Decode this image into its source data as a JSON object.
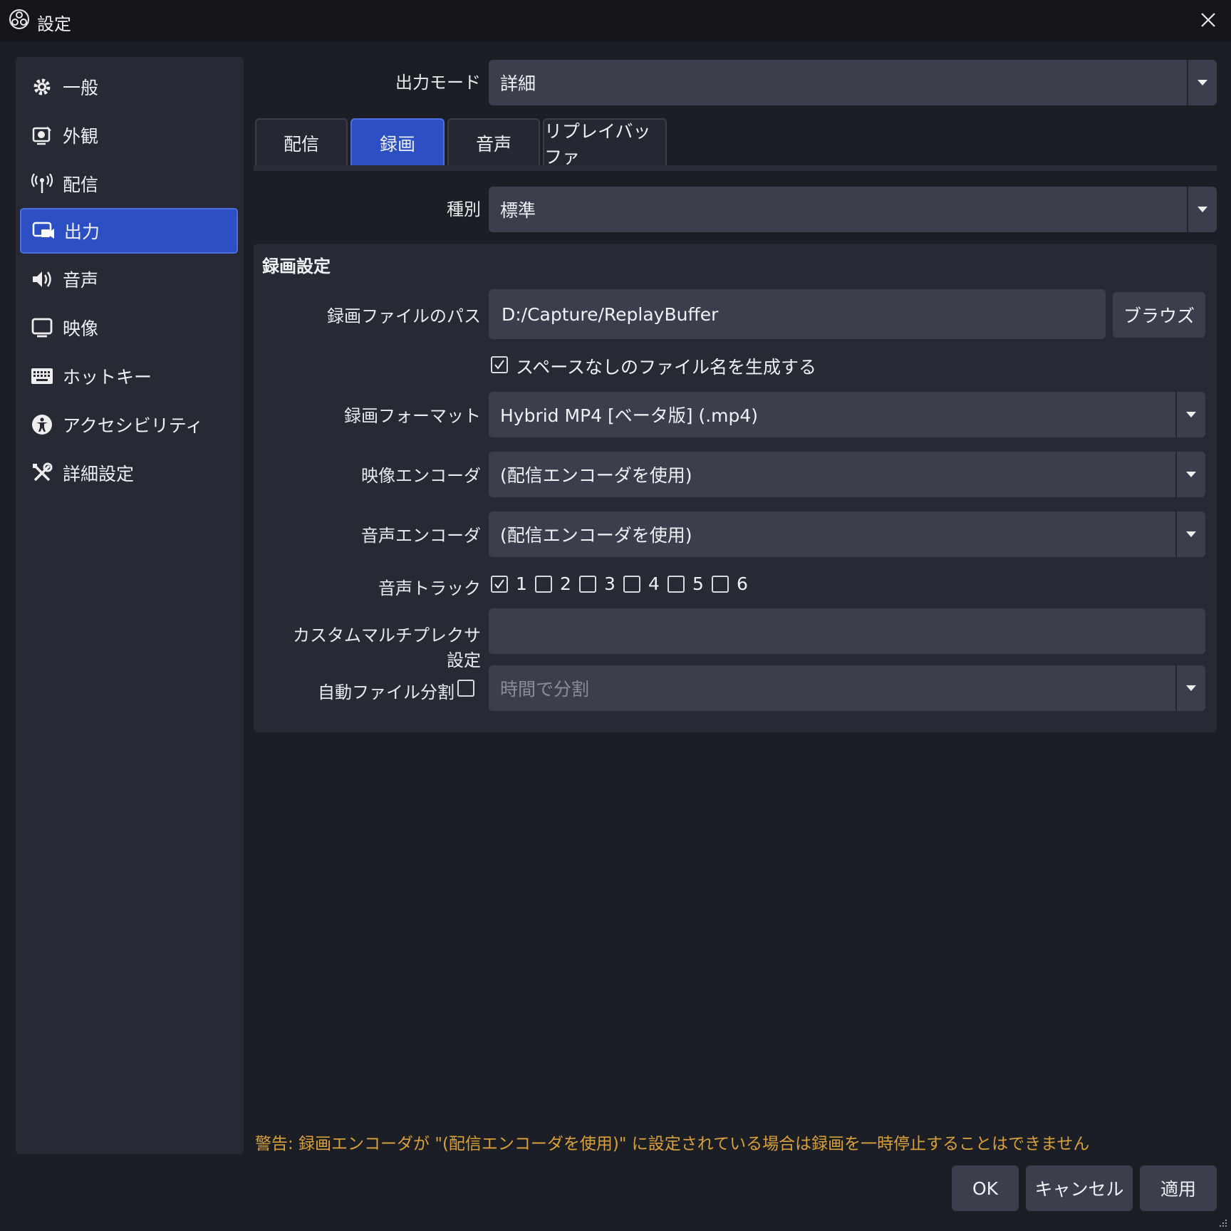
{
  "window": {
    "title": "設定",
    "accent": "#2d4fc4",
    "warning_color": "#d8a03a"
  },
  "sidebar": {
    "items": [
      {
        "label": "一般",
        "icon": "gear-icon"
      },
      {
        "label": "外観",
        "icon": "appearance-icon"
      },
      {
        "label": "配信",
        "icon": "antenna-icon"
      },
      {
        "label": "出力",
        "icon": "output-icon",
        "active": true
      },
      {
        "label": "音声",
        "icon": "speaker-icon"
      },
      {
        "label": "映像",
        "icon": "monitor-icon"
      },
      {
        "label": "ホットキー",
        "icon": "keyboard-icon"
      },
      {
        "label": "アクセシビリティ",
        "icon": "accessibility-icon"
      },
      {
        "label": "詳細設定",
        "icon": "tools-icon"
      }
    ]
  },
  "output_mode": {
    "label": "出力モード",
    "value": "詳細"
  },
  "tabs": [
    {
      "label": "配信"
    },
    {
      "label": "録画",
      "active": true
    },
    {
      "label": "音声"
    },
    {
      "label": "リプレイバッファ"
    }
  ],
  "type": {
    "label": "種別",
    "value": "標準"
  },
  "recording": {
    "group_title": "録画設定",
    "path_label": "録画ファイルのパス",
    "path_value": "D:/Capture/ReplayBuffer",
    "browse_label": "ブラウズ",
    "no_space_label": "スペースなしのファイル名を生成する",
    "no_space_checked": true,
    "format_label": "録画フォーマット",
    "format_value": "Hybrid MP4 [ベータ版] (.mp4)",
    "video_encoder_label": "映像エンコーダ",
    "video_encoder_value": "(配信エンコーダを使用)",
    "audio_encoder_label": "音声エンコーダ",
    "audio_encoder_value": "(配信エンコーダを使用)",
    "tracks_label": "音声トラック",
    "tracks": [
      {
        "label": "1",
        "checked": true
      },
      {
        "label": "2",
        "checked": false
      },
      {
        "label": "3",
        "checked": false
      },
      {
        "label": "4",
        "checked": false
      },
      {
        "label": "5",
        "checked": false
      },
      {
        "label": "6",
        "checked": false
      }
    ],
    "muxer_label": "カスタムマルチプレクサ設定",
    "muxer_value": "",
    "split_label": "自動ファイル分割",
    "split_checked": false,
    "split_value": "時間で分割"
  },
  "warning": "警告: 録画エンコーダが \"(配信エンコーダを使用)\" に設定されている場合は録画を一時停止することはできません",
  "buttons": {
    "ok": "OK",
    "cancel": "キャンセル",
    "apply": "適用"
  }
}
